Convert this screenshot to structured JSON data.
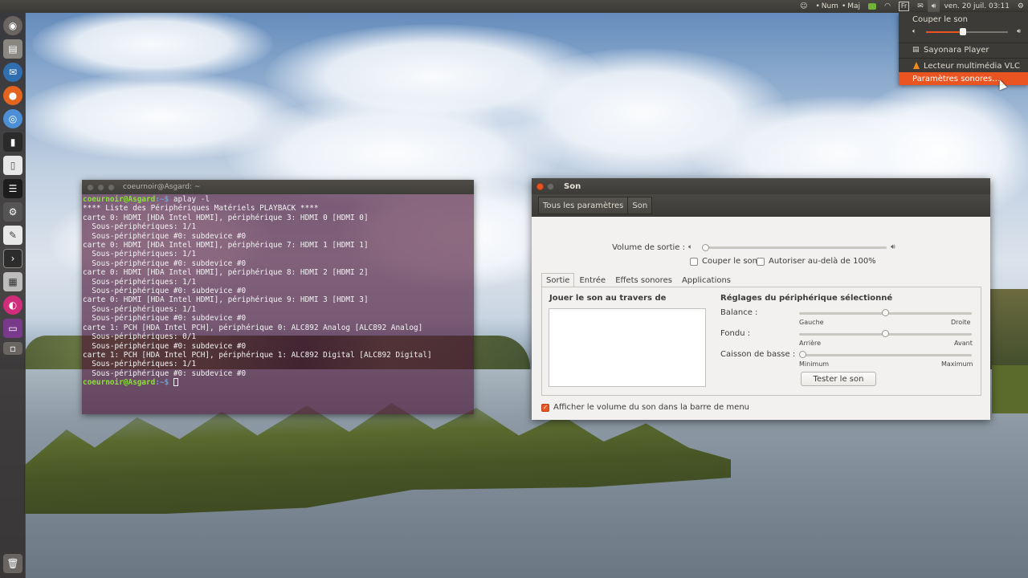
{
  "top_panel": {
    "keyboard_indicator": "Num",
    "caps_indicator": "Maj",
    "input_method": "Fr",
    "clock": "ven. 20 juil. 03:11"
  },
  "sound_menu": {
    "mute": "Couper le son",
    "volume_fraction": 0.45,
    "app1": "Sayonara Player",
    "app2": "Lecteur multimédia VLC",
    "settings": "Paramètres sonores…"
  },
  "terminal": {
    "title": "coeurnoir@Asgard: ~",
    "prompt_user": "coeurnoir@Asgard",
    "prompt_path": ":~$",
    "command": " aplay -l",
    "lines": [
      "**** Liste des Périphériques Matériels PLAYBACK ****",
      "carte 0: HDMI [HDA Intel HDMI], périphérique 3: HDMI 0 [HDMI 0]",
      "  Sous-périphériques: 1/1",
      "  Sous-périphérique #0: subdevice #0",
      "carte 0: HDMI [HDA Intel HDMI], périphérique 7: HDMI 1 [HDMI 1]",
      "  Sous-périphériques: 1/1",
      "  Sous-périphérique #0: subdevice #0",
      "carte 0: HDMI [HDA Intel HDMI], périphérique 8: HDMI 2 [HDMI 2]",
      "  Sous-périphériques: 1/1",
      "  Sous-périphérique #0: subdevice #0",
      "carte 0: HDMI [HDA Intel HDMI], périphérique 9: HDMI 3 [HDMI 3]",
      "  Sous-périphériques: 1/1",
      "  Sous-périphérique #0: subdevice #0",
      "carte 1: PCH [HDA Intel PCH], périphérique 0: ALC892 Analog [ALC892 Analog]",
      "  Sous-périphériques: 0/1",
      "  Sous-périphérique #0: subdevice #0",
      "carte 1: PCH [HDA Intel PCH], périphérique 1: ALC892 Digital [ALC892 Digital]",
      "  Sous-périphériques: 1/1",
      "  Sous-périphérique #0: subdevice #0"
    ]
  },
  "son_window": {
    "title": "Son",
    "toolbar": {
      "all_settings": "Tous les paramètres",
      "current": "Son"
    },
    "output_volume_label": "Volume de sortie :",
    "output_volume_fraction": 0.0,
    "mute_label": "Couper le son",
    "mute_checked": false,
    "overamp_label": "Autoriser au-delà de 100%",
    "overamp_checked": false,
    "tabs": [
      "Sortie",
      "Entrée",
      "Effets sonores",
      "Applications"
    ],
    "active_tab": "Sortie",
    "device_list_heading": "Jouer le son au travers de",
    "device_settings_heading": "Réglages du périphérique sélectionné",
    "balance": {
      "label": "Balance :",
      "left": "Gauche",
      "right": "Droite",
      "value": 0.5
    },
    "fade": {
      "label": "Fondu :",
      "left": "Arrière",
      "right": "Avant",
      "value": 0.5
    },
    "subwoofer": {
      "label": "Caisson de basse :",
      "left": "Minimum",
      "right": "Maximum",
      "value": 0.0
    },
    "test_button": "Tester le son",
    "show_in_menubar_label": "Afficher le volume du son dans la barre de menu",
    "show_in_menubar_checked": true
  },
  "colors": {
    "accent": "#e95420",
    "prompt_green": "#8ae234",
    "prompt_blue": "#729fcf",
    "panel_dark": "#3c3b37"
  }
}
